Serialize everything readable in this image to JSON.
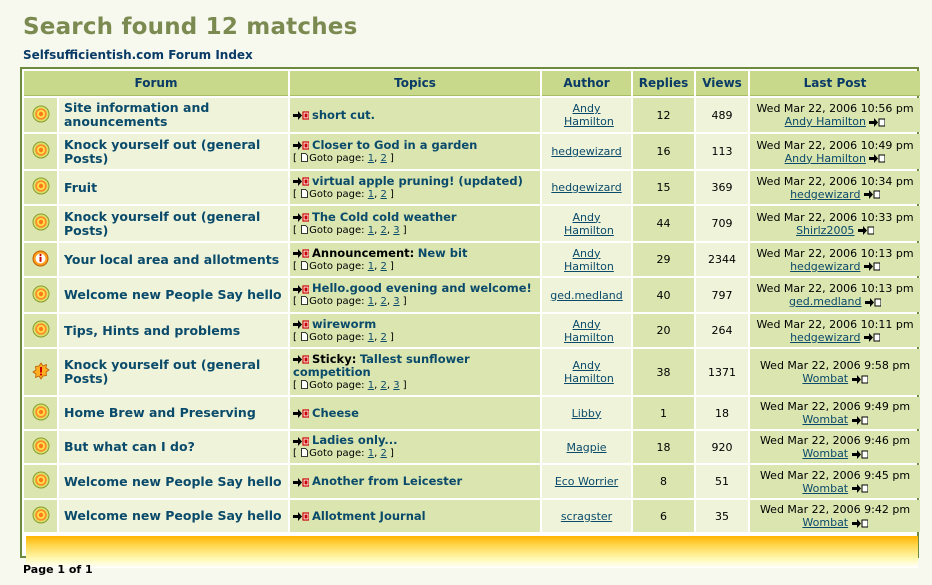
{
  "title": "Search found 12 matches",
  "breadcrumb": "Selfsufficientish.com Forum Index",
  "headers": {
    "forum": "Forum",
    "topics": "Topics",
    "author": "Author",
    "replies": "Replies",
    "views": "Views",
    "last_post": "Last Post"
  },
  "goto_label": "Goto page:",
  "rows": [
    {
      "icon": "folder",
      "forum": "Site information and anouncements",
      "prefix": "",
      "topic": "short cut.",
      "pages": [],
      "author": "Andy Hamilton",
      "replies": "12",
      "views": "489",
      "last_date": "Wed Mar 22, 2006 10:56 pm",
      "last_author": "Andy Hamilton"
    },
    {
      "icon": "folder",
      "forum": "Knock yourself out (general Posts)",
      "prefix": "",
      "topic": "Closer to God in a garden",
      "pages": [
        "1",
        "2"
      ],
      "author": "hedgewizard",
      "replies": "16",
      "views": "113",
      "last_date": "Wed Mar 22, 2006 10:49 pm",
      "last_author": "Andy Hamilton"
    },
    {
      "icon": "folder",
      "forum": "Fruit",
      "prefix": "",
      "topic": "virtual apple pruning! (updated)",
      "pages": [
        "1",
        "2"
      ],
      "author": "hedgewizard",
      "replies": "15",
      "views": "369",
      "last_date": "Wed Mar 22, 2006 10:34 pm",
      "last_author": "hedgewizard"
    },
    {
      "icon": "folder",
      "forum": "Knock yourself out (general Posts)",
      "prefix": "",
      "topic": "The Cold cold weather",
      "pages": [
        "1",
        "2",
        "3"
      ],
      "author": "Andy Hamilton",
      "replies": "44",
      "views": "709",
      "last_date": "Wed Mar 22, 2006 10:33 pm",
      "last_author": "Shirlz2005"
    },
    {
      "icon": "announce",
      "forum": "Your local area and allotments",
      "prefix": "Announcement:",
      "topic": "New bit",
      "pages": [
        "1",
        "2"
      ],
      "author": "Andy Hamilton",
      "replies": "29",
      "views": "2344",
      "last_date": "Wed Mar 22, 2006 10:13 pm",
      "last_author": "hedgewizard"
    },
    {
      "icon": "folder",
      "forum": "Welcome new People Say hello",
      "prefix": "",
      "topic": "Hello.good evening and welcome!",
      "pages": [
        "1",
        "2",
        "3"
      ],
      "author": "ged.medland",
      "replies": "40",
      "views": "797",
      "last_date": "Wed Mar 22, 2006 10:13 pm",
      "last_author": "ged.medland"
    },
    {
      "icon": "folder",
      "forum": "Tips, Hints and problems",
      "prefix": "",
      "topic": "wireworm",
      "pages": [
        "1",
        "2"
      ],
      "author": "Andy Hamilton",
      "replies": "20",
      "views": "264",
      "last_date": "Wed Mar 22, 2006 10:11 pm",
      "last_author": "hedgewizard"
    },
    {
      "icon": "sticky",
      "forum": "Knock yourself out (general Posts)",
      "prefix": "Sticky:",
      "topic": "Tallest sunflower competition",
      "pages": [
        "1",
        "2",
        "3"
      ],
      "author": "Andy Hamilton",
      "replies": "38",
      "views": "1371",
      "last_date": "Wed Mar 22, 2006 9:58 pm",
      "last_author": "Wombat"
    },
    {
      "icon": "folder",
      "forum": "Home Brew and Preserving",
      "prefix": "",
      "topic": "Cheese",
      "pages": [],
      "author": "Libby",
      "replies": "1",
      "views": "18",
      "last_date": "Wed Mar 22, 2006 9:49 pm",
      "last_author": "Wombat"
    },
    {
      "icon": "folder",
      "forum": "But what can I do?",
      "prefix": "",
      "topic": "Ladies only...",
      "pages": [
        "1",
        "2"
      ],
      "author": "Magpie",
      "replies": "18",
      "views": "920",
      "last_date": "Wed Mar 22, 2006 9:46 pm",
      "last_author": "Wombat"
    },
    {
      "icon": "folder",
      "forum": "Welcome new People Say hello",
      "prefix": "",
      "topic": "Another from Leicester",
      "pages": [],
      "author": "Eco Worrier",
      "replies": "8",
      "views": "51",
      "last_date": "Wed Mar 22, 2006 9:45 pm",
      "last_author": "Wombat"
    },
    {
      "icon": "folder",
      "forum": "Welcome new People Say hello",
      "prefix": "",
      "topic": "Allotment Journal",
      "pages": [],
      "author": "scragster",
      "replies": "6",
      "views": "35",
      "last_date": "Wed Mar 22, 2006 9:42 pm",
      "last_author": "Wombat"
    }
  ],
  "pagination": "Page 1 of 1",
  "colors": {
    "accent": "#7a8a50",
    "link": "#0a4a6a",
    "header_bg": "#c8d98c",
    "border": "#6e8a3c"
  }
}
